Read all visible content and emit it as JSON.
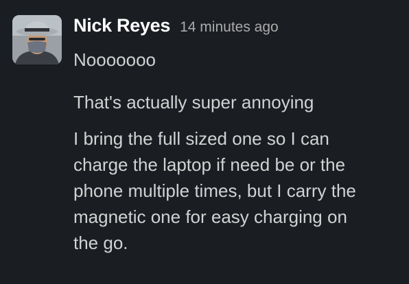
{
  "message": {
    "author": "Nick Reyes",
    "timestamp": "14 minutes ago",
    "lines": [
      "Nooooooo",
      "That's actually super annoying"
    ],
    "paragraph": [
      "I bring the full sized one so I can",
      "charge the laptop if need be or the",
      "phone multiple times, but I carry the",
      "magnetic one for easy charging on",
      "the go."
    ]
  },
  "colors": {
    "background": "#1a1d21",
    "author": "#ffffff",
    "text": "#d1d2d3",
    "timestamp": "#ababad"
  },
  "icons": {
    "avatar": "user-avatar-photo"
  }
}
